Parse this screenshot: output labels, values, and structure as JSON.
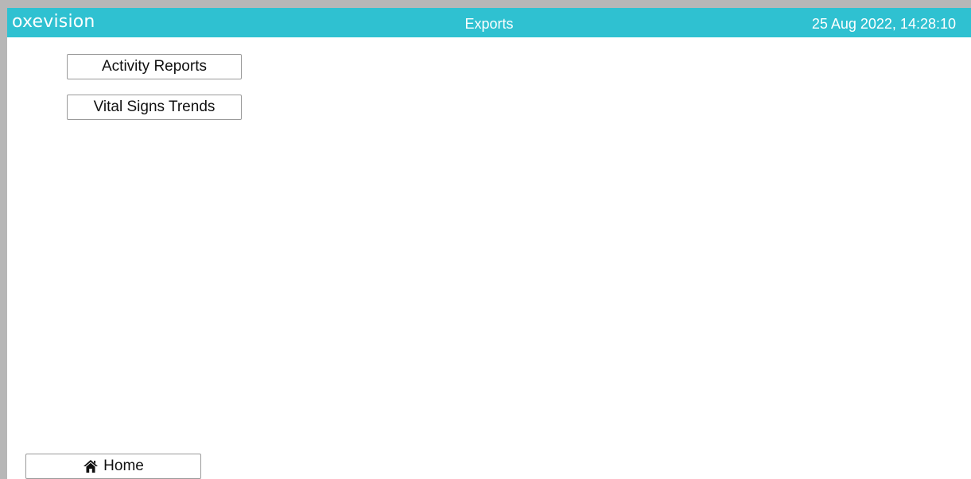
{
  "header": {
    "logo": "oxevision",
    "title": "Exports",
    "datetime": "25 Aug 2022, 14:28:10",
    "background_color": "#2fc1d1"
  },
  "main": {
    "buttons": [
      {
        "label": "Activity Reports"
      },
      {
        "label": "Vital Signs Trends"
      }
    ]
  },
  "footer": {
    "home_label": "Home",
    "home_icon": "home-icon"
  }
}
